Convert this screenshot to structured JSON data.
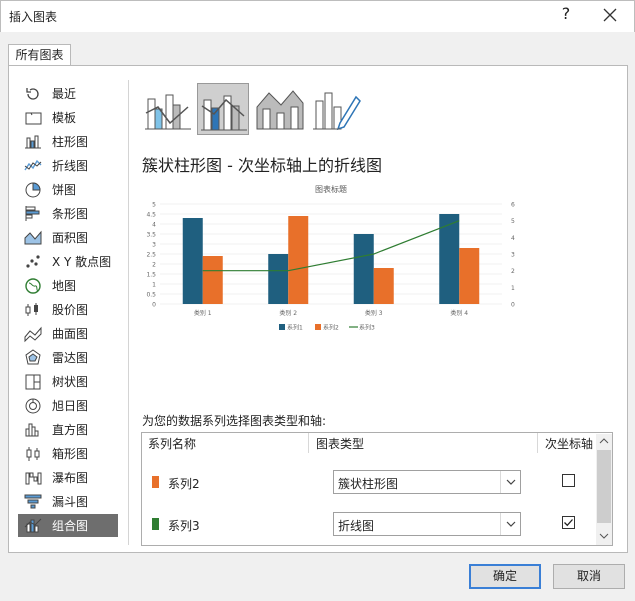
{
  "window": {
    "title": "插入图表",
    "help": "?"
  },
  "tab": "所有图表",
  "categories": [
    {
      "label": "最近",
      "icon": "recent-icon"
    },
    {
      "label": "模板",
      "icon": "folder-icon"
    },
    {
      "label": "柱形图",
      "icon": "column-chart-icon"
    },
    {
      "label": "折线图",
      "icon": "line-chart-icon"
    },
    {
      "label": "饼图",
      "icon": "pie-chart-icon"
    },
    {
      "label": "条形图",
      "icon": "bar-chart-icon"
    },
    {
      "label": "面积图",
      "icon": "area-chart-icon"
    },
    {
      "label": "X Y 散点图",
      "icon": "scatter-chart-icon"
    },
    {
      "label": "地图",
      "icon": "map-chart-icon"
    },
    {
      "label": "股价图",
      "icon": "stock-chart-icon"
    },
    {
      "label": "曲面图",
      "icon": "surface-chart-icon"
    },
    {
      "label": "雷达图",
      "icon": "radar-chart-icon"
    },
    {
      "label": "树状图",
      "icon": "treemap-chart-icon"
    },
    {
      "label": "旭日图",
      "icon": "sunburst-chart-icon"
    },
    {
      "label": "直方图",
      "icon": "histogram-chart-icon"
    },
    {
      "label": "箱形图",
      "icon": "boxplot-chart-icon"
    },
    {
      "label": "瀑布图",
      "icon": "waterfall-chart-icon"
    },
    {
      "label": "漏斗图",
      "icon": "funnel-chart-icon"
    },
    {
      "label": "组合图",
      "icon": "combo-chart-icon"
    }
  ],
  "selected_category": 18,
  "subtype_title": "簇状柱形图 - 次坐标轴上的折线图",
  "preview": {
    "title": "图表标题",
    "categories": [
      "类别 1",
      "类别 2",
      "类别 3",
      "类别 4"
    ],
    "legend": [
      "系列1",
      "系列2",
      "系列3"
    ],
    "colors": [
      "#1f5f7f",
      "#e8702a",
      "#2f7d32"
    ],
    "left_ticks": [
      "0",
      "0.5",
      "1",
      "1.5",
      "2",
      "2.5",
      "3",
      "3.5",
      "4",
      "4.5",
      "5"
    ],
    "right_ticks": [
      "0",
      "1",
      "2",
      "3",
      "4",
      "5",
      "6"
    ]
  },
  "chart_data": {
    "type": "bar",
    "title": "图表标题",
    "categories": [
      "类别 1",
      "类别 2",
      "类别 3",
      "类别 4"
    ],
    "series": [
      {
        "name": "系列1",
        "type": "bar",
        "axis": "primary",
        "values": [
          4.3,
          2.5,
          3.5,
          4.5
        ]
      },
      {
        "name": "系列2",
        "type": "bar",
        "axis": "primary",
        "values": [
          2.4,
          4.4,
          1.8,
          2.8
        ]
      },
      {
        "name": "系列3",
        "type": "line",
        "axis": "secondary",
        "values": [
          2,
          2,
          3,
          5
        ]
      }
    ],
    "ylim": [
      0,
      5
    ],
    "y2lim": [
      0,
      6
    ],
    "legend": "bottom"
  },
  "instruction": "为您的数据系列选择图表类型和轴:",
  "table": {
    "headers": [
      "系列名称",
      "图表类型",
      "次坐标轴"
    ],
    "rows": [
      {
        "name": "系列2",
        "color": "#e8702a",
        "type": "簇状柱形图",
        "secondary": false
      },
      {
        "name": "系列3",
        "color": "#2f7d32",
        "type": "折线图",
        "secondary": true
      }
    ]
  },
  "buttons": {
    "ok": "确定",
    "cancel": "取消"
  }
}
